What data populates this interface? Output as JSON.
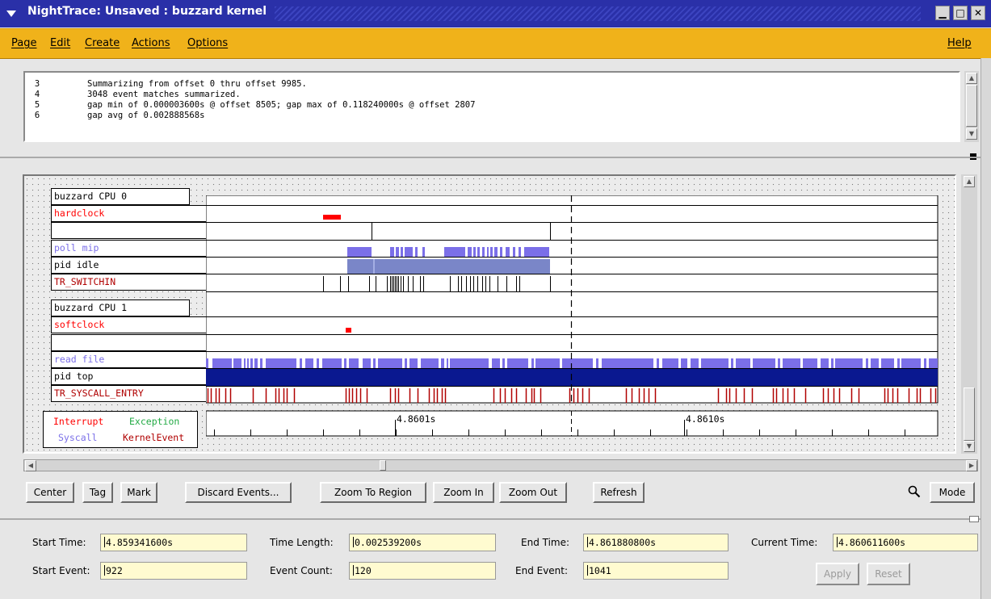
{
  "window": {
    "title": "NightTrace: Unsaved : buzzard kernel",
    "buttons": {
      "minimize": "▁",
      "maximize": "□",
      "close": "✕"
    }
  },
  "menubar": {
    "items": [
      "Page",
      "Edit",
      "Create",
      "Actions",
      "Options"
    ],
    "help": "Help"
  },
  "messages": [
    {
      "num": "3",
      "text": "Summarizing from offset 0 thru offset 9985."
    },
    {
      "num": "4",
      "text": "3048 event matches summarized."
    },
    {
      "num": "5",
      "text": "gap min of 0.000003600s @ offset 8505; gap max of 0.118240000s @ offset 2807"
    },
    {
      "num": "6",
      "text": "gap avg of 0.002888568s"
    }
  ],
  "trace": {
    "rows": [
      {
        "label": "buzzard CPU 0",
        "kind": "header"
      },
      {
        "label": "hardclock",
        "color": "#ff0000"
      },
      {
        "label": "",
        "color": "#000000"
      },
      {
        "label": "poll mip",
        "color": "#7b6fe8"
      },
      {
        "label": "pid idle",
        "color": "#000000"
      },
      {
        "label": "TR_SWITCHIN",
        "color": "#b00000"
      },
      {
        "label": "buzzard CPU 1",
        "kind": "header"
      },
      {
        "label": "softclock",
        "color": "#ff0000"
      },
      {
        "label": "",
        "color": "#000000"
      },
      {
        "label": "read file",
        "color": "#7b6fe8"
      },
      {
        "label": "pid top",
        "color": "#000000"
      },
      {
        "label": "TR_SYSCALL_ENTRY",
        "color": "#b00000"
      }
    ],
    "legend": {
      "interrupt": "Interrupt",
      "exception": "Exception",
      "syscall": "Syscall",
      "kernel_event": "KernelEvent"
    },
    "ruler_labels": [
      "4.8601s",
      "4.8610s"
    ],
    "colors": {
      "interrupt": "#ff0000",
      "exception": "#22aa44",
      "syscall": "#7b6fe8",
      "kernel_event": "#b00000",
      "pid_bar": "#0a1890",
      "idle_bar": "#7a86c8"
    }
  },
  "toolbar": {
    "center": "Center",
    "tag": "Tag",
    "mark": "Mark",
    "discard": "Discard Events...",
    "zoom_region": "Zoom To Region",
    "zoom_in": "Zoom In",
    "zoom_out": "Zoom Out",
    "refresh": "Refresh",
    "mode": "Mode"
  },
  "fields": {
    "start_time_label": "Start Time:",
    "start_time": "4.859341600s",
    "time_length_label": "Time Length:",
    "time_length": "0.002539200s",
    "end_time_label": "End Time:",
    "end_time": "4.861880800s",
    "current_time_label": "Current Time:",
    "current_time": "4.860611600s",
    "start_event_label": "Start Event:",
    "start_event": "922",
    "event_count_label": "Event Count:",
    "event_count": "120",
    "end_event_label": "End Event:",
    "end_event": "1041"
  },
  "footer": {
    "apply": "Apply",
    "reset": "Reset"
  }
}
